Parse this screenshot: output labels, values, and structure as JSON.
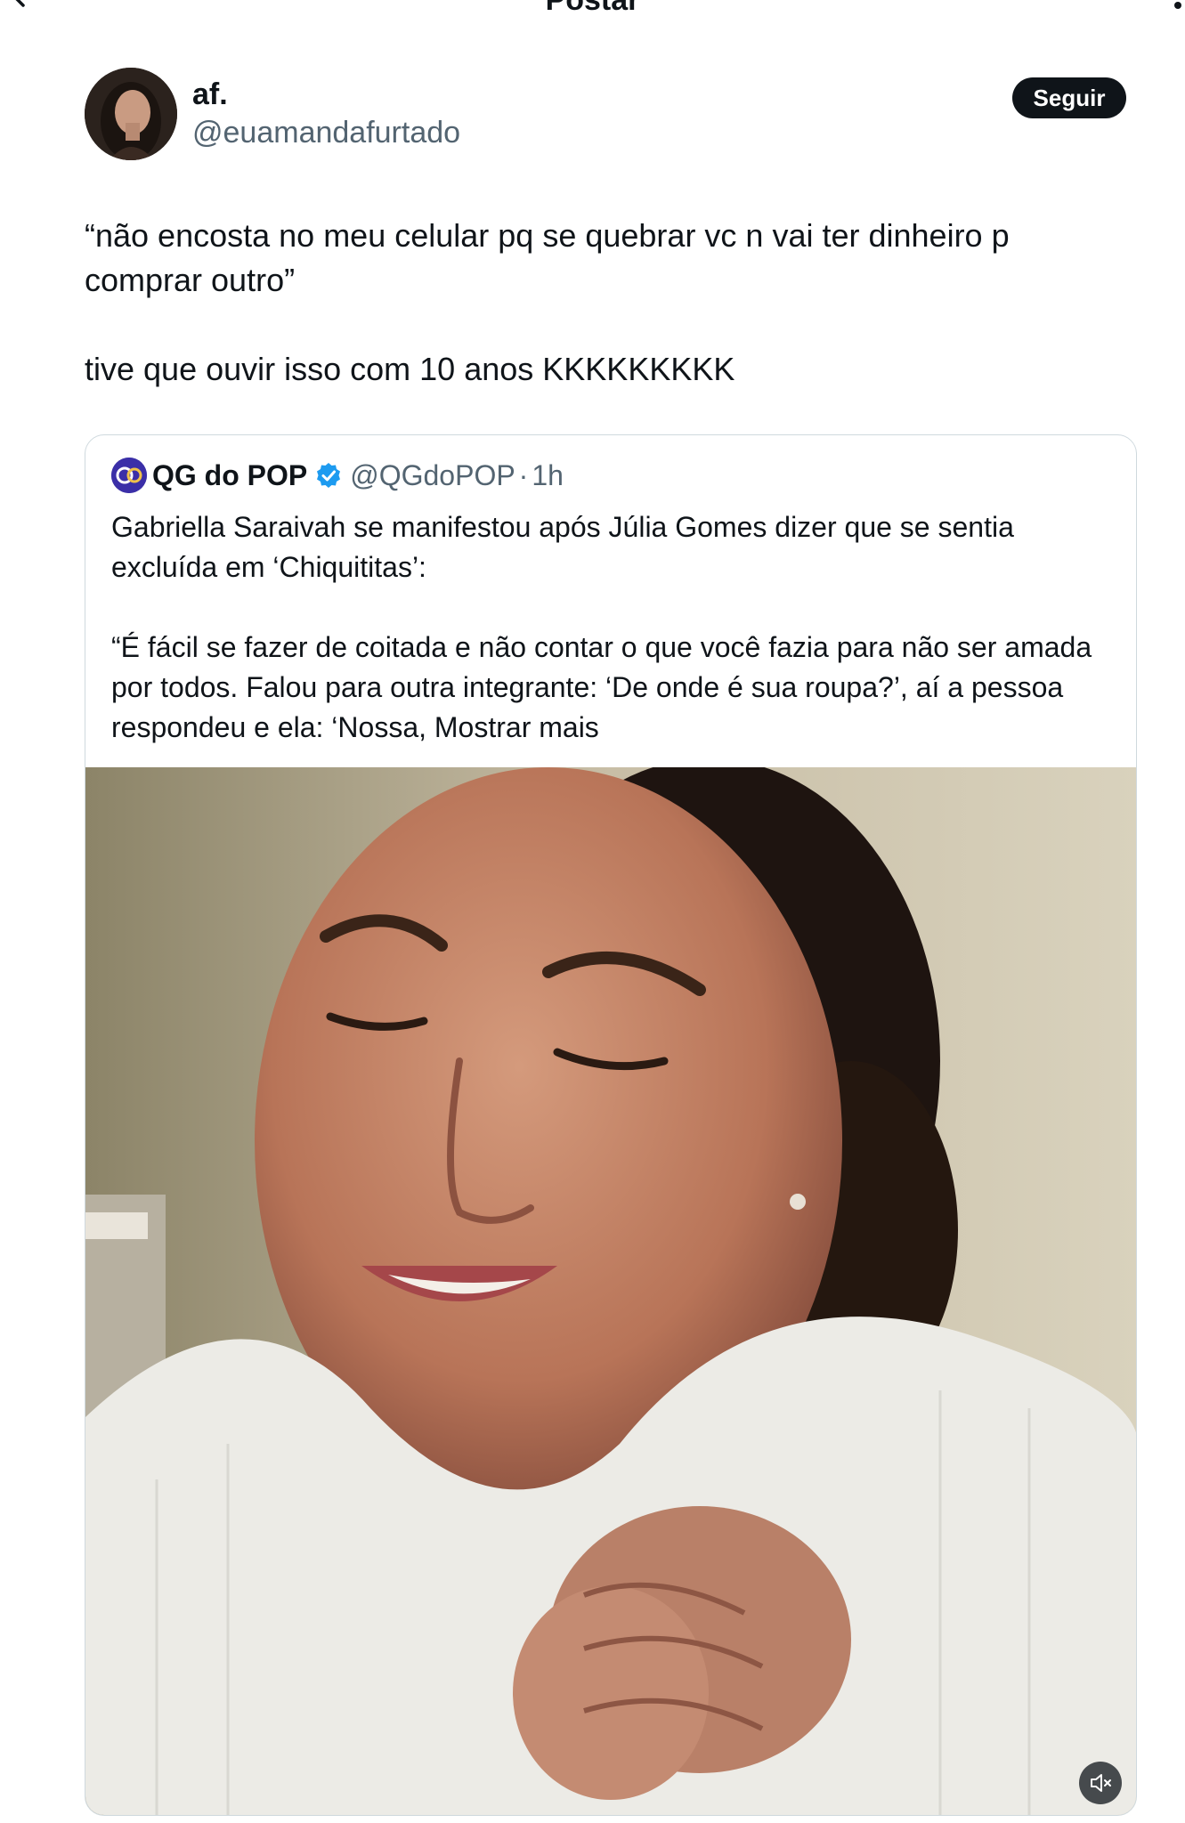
{
  "header": {
    "title": "Postar"
  },
  "tweet": {
    "author": {
      "display_name": "af.",
      "handle": "@euamandafurtado"
    },
    "follow_label": "Seguir",
    "text_lines": [
      "“não encosta no meu celular pq se quebrar vc n vai ter dinheiro p comprar outro”",
      "tive que ouvir isso com 10 anos KKKKKKKKK"
    ]
  },
  "quote": {
    "name": "QG do POP",
    "handle": "@QGdoPOP",
    "dot": "·",
    "time": "1h",
    "paragraphs": [
      "Gabriella Saraivah se manifestou após Júlia Gomes dizer que se sentia excluída em ‘Chiquititas’:",
      "“É fácil se fazer de coitada e não contar o que você fazia para não ser amada por todos. Falou para outra integrante: ‘De onde é sua roupa?’, aí a pessoa respondeu e ela: ‘Nossa, Mostrar mais"
    ]
  },
  "icons": {
    "back": "arrow-left-icon",
    "more": "more-icon",
    "verified": "verified-badge-icon",
    "mute": "speaker-muted-icon"
  },
  "colors": {
    "text_primary": "#0f1419",
    "text_secondary": "#536471",
    "border": "#cfd9de",
    "verified": "#1d9bf0",
    "follow_bg": "#0f1419"
  }
}
